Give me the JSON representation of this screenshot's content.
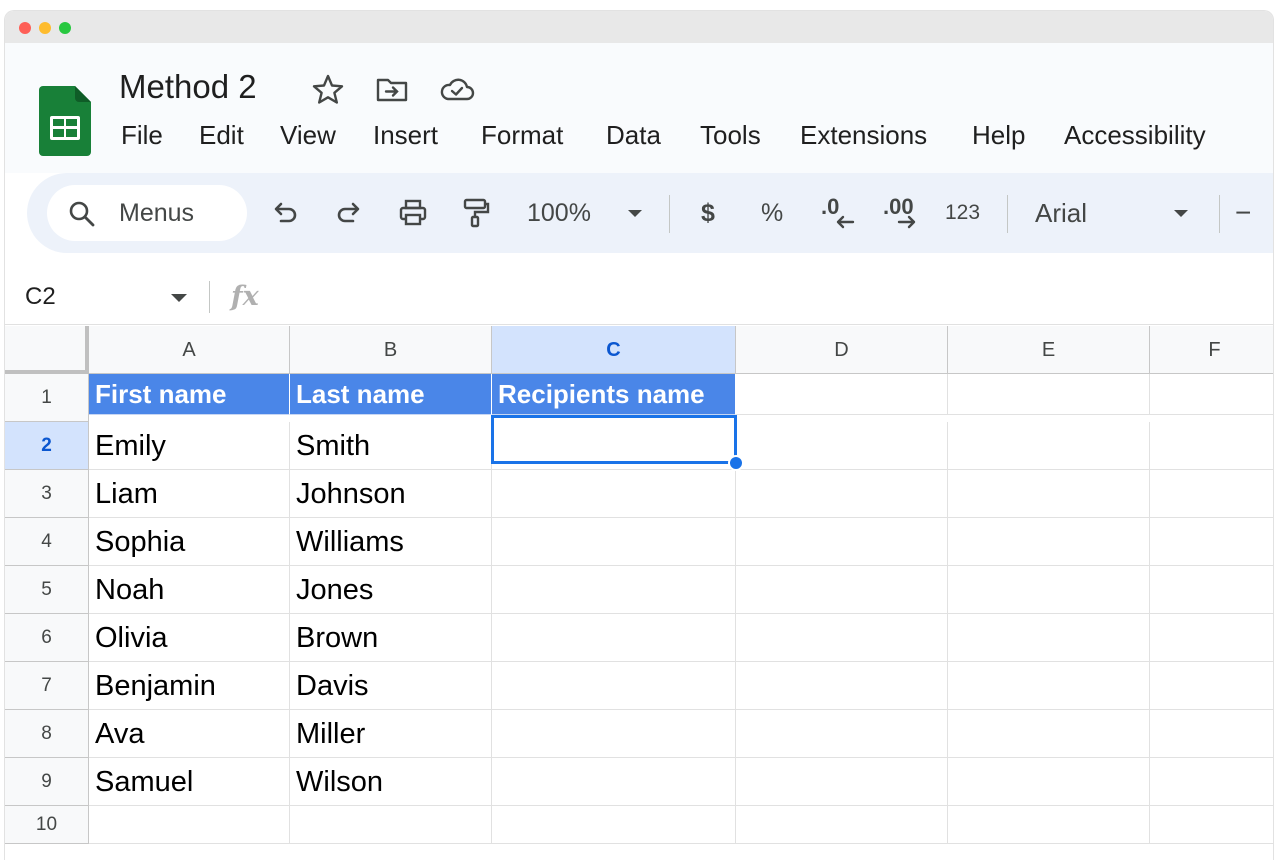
{
  "document": {
    "title": "Method 2"
  },
  "menu": [
    "File",
    "Edit",
    "View",
    "Insert",
    "Format",
    "Data",
    "Tools",
    "Extensions",
    "Help",
    "Accessibility"
  ],
  "toolbar": {
    "search_label": "Menus",
    "zoom": "100%",
    "currency": "$",
    "percent": "%",
    "decrease_decimal": ".0",
    "increase_decimal": ".00",
    "number_format": "123",
    "font": "Arial",
    "font_size_minus": "−"
  },
  "formula_bar": {
    "cell_ref": "C2",
    "fx": "fx"
  },
  "columns": [
    "A",
    "B",
    "C",
    "D",
    "E",
    "F"
  ],
  "rows": [
    "1",
    "2",
    "3",
    "4",
    "5",
    "6",
    "7",
    "8",
    "9",
    "10"
  ],
  "sheet": {
    "headers": [
      "First name",
      "Last name",
      "Recipients name"
    ],
    "data": [
      [
        "Emily",
        "Smith",
        ""
      ],
      [
        "Liam",
        "Johnson",
        ""
      ],
      [
        "Sophia",
        "Williams",
        ""
      ],
      [
        "Noah",
        "Jones",
        ""
      ],
      [
        "Olivia",
        "Brown",
        ""
      ],
      [
        "Benjamin",
        "Davis",
        ""
      ],
      [
        "Ava",
        "Miller",
        ""
      ],
      [
        "Samuel",
        "Wilson",
        ""
      ]
    ]
  },
  "selection": {
    "cell": "C2",
    "column": "C",
    "row": "2"
  },
  "colors": {
    "header_fill": "#4a86e8",
    "selection": "#1a73e8",
    "selected_header": "#d3e3fd",
    "sheets_green": "#188038"
  }
}
